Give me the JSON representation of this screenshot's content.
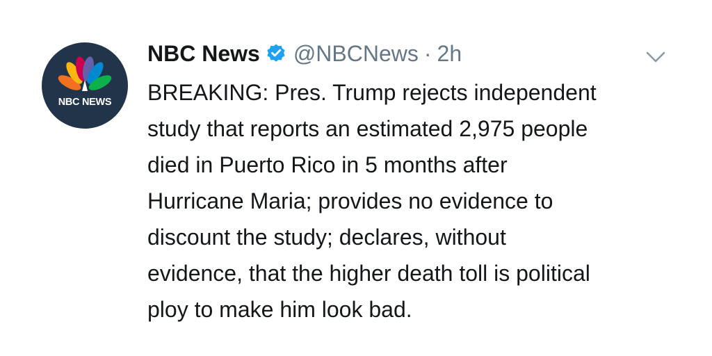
{
  "tweet": {
    "author_name": "NBC News",
    "handle": "@NBCNews",
    "separator": "·",
    "time": "2h",
    "verified": true,
    "avatar": {
      "logo_text": "NBC NEWS",
      "background": "#22344a",
      "peacock_colors": [
        "#f37021",
        "#fcb711",
        "#cc004c",
        "#6460aa",
        "#0089d0",
        "#0db14b"
      ]
    },
    "text_lines": [
      "BREAKING: Pres. Trump rejects independent",
      "study that reports an estimated 2,975 people",
      "died in Puerto Rico in 5 months after",
      "Hurricane Maria; provides no evidence to",
      "discount the study; declares, without",
      "evidence, that the higher death toll is political",
      "ploy to make him look bad."
    ],
    "icons": {
      "verified": "verified-badge-icon",
      "menu": "chevron-down-icon"
    },
    "colors": {
      "text": "#14171a",
      "secondary": "#657786",
      "verified": "#1da1f2"
    }
  }
}
